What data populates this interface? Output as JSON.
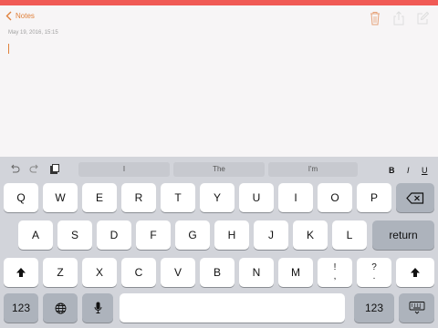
{
  "nav": {
    "back_label": "Notes"
  },
  "note": {
    "date": "May 19, 2016, 15:15"
  },
  "toolbar": {
    "suggestions": [
      "I",
      "The",
      "I'm"
    ],
    "bold_label": "B",
    "italic_label": "I",
    "underline_label": "U"
  },
  "keyboard": {
    "row1": [
      "Q",
      "W",
      "E",
      "R",
      "T",
      "Y",
      "U",
      "I",
      "O",
      "P"
    ],
    "row2": [
      "A",
      "S",
      "D",
      "F",
      "G",
      "H",
      "J",
      "K",
      "L"
    ],
    "row3": [
      "Z",
      "X",
      "C",
      "V",
      "B",
      "N",
      "M"
    ],
    "exclaim_top": "!",
    "exclaim_bottom": ",",
    "question_top": "?",
    "question_bottom": ".",
    "return_label": "return",
    "numbers_label": "123"
  },
  "colors": {
    "accent": "#e0813c",
    "status_bar": "#f05a55",
    "keyboard_bg": "#d2d4da"
  }
}
